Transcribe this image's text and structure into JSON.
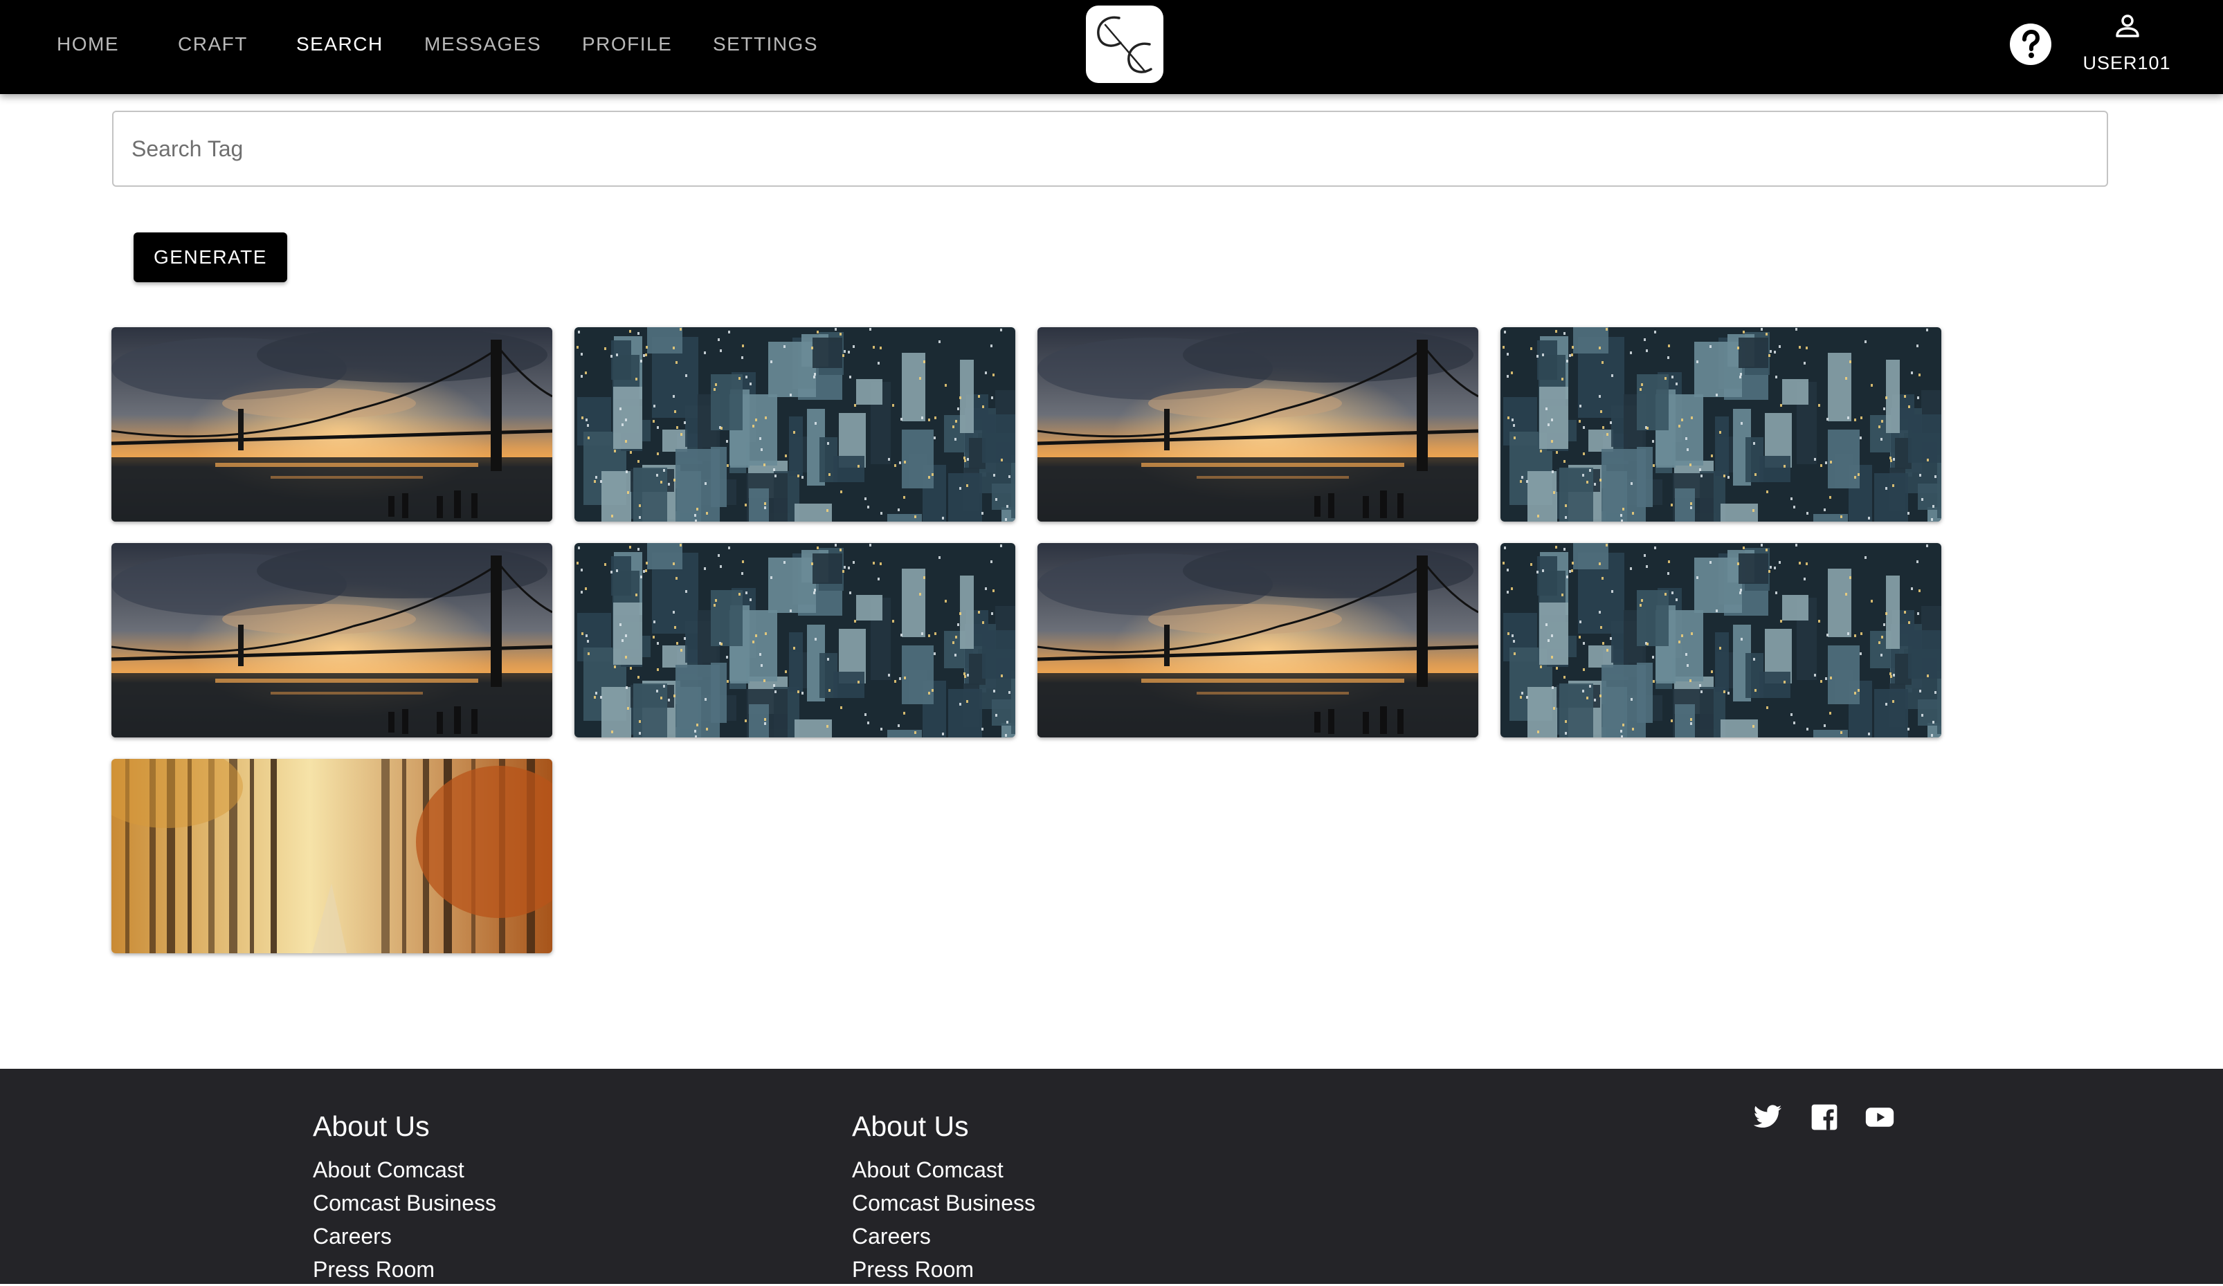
{
  "nav": {
    "links": [
      {
        "label": "HOME"
      },
      {
        "label": "CRAFT"
      },
      {
        "label": "SEARCH"
      },
      {
        "label": "MESSAGES"
      },
      {
        "label": "PROFILE"
      },
      {
        "label": "SETTINGS"
      }
    ],
    "active": "SEARCH",
    "logo_icon": "cc-monogram-logo",
    "help_icon": "help-circle-icon",
    "user_icon": "person-icon",
    "username": "USER101"
  },
  "search": {
    "placeholder": "Search Tag",
    "value": ""
  },
  "generate_label": "GENERATE",
  "gallery": {
    "images": [
      {
        "scene": "bridge-sunset"
      },
      {
        "scene": "city-aerial"
      },
      {
        "scene": "bridge-sunset"
      },
      {
        "scene": "city-aerial"
      },
      {
        "scene": "bridge-sunset"
      },
      {
        "scene": "city-aerial"
      },
      {
        "scene": "bridge-sunset"
      },
      {
        "scene": "city-aerial"
      },
      {
        "scene": "autumn-forest"
      }
    ]
  },
  "footer": {
    "columns": [
      {
        "heading": "About Us",
        "links": [
          "About Comcast",
          "Comcast Business",
          "Careers",
          "Press Room"
        ]
      },
      {
        "heading": "About Us",
        "links": [
          "About Comcast",
          "Comcast Business",
          "Careers",
          "Press Room"
        ]
      }
    ],
    "social_icons": [
      "twitter-icon",
      "facebook-icon",
      "youtube-icon"
    ]
  },
  "colors": {
    "nav_bg": "#000000",
    "nav_text": "#b9b9b9",
    "nav_active": "#ffffff",
    "button_bg": "#000000",
    "footer_bg": "#242428"
  }
}
